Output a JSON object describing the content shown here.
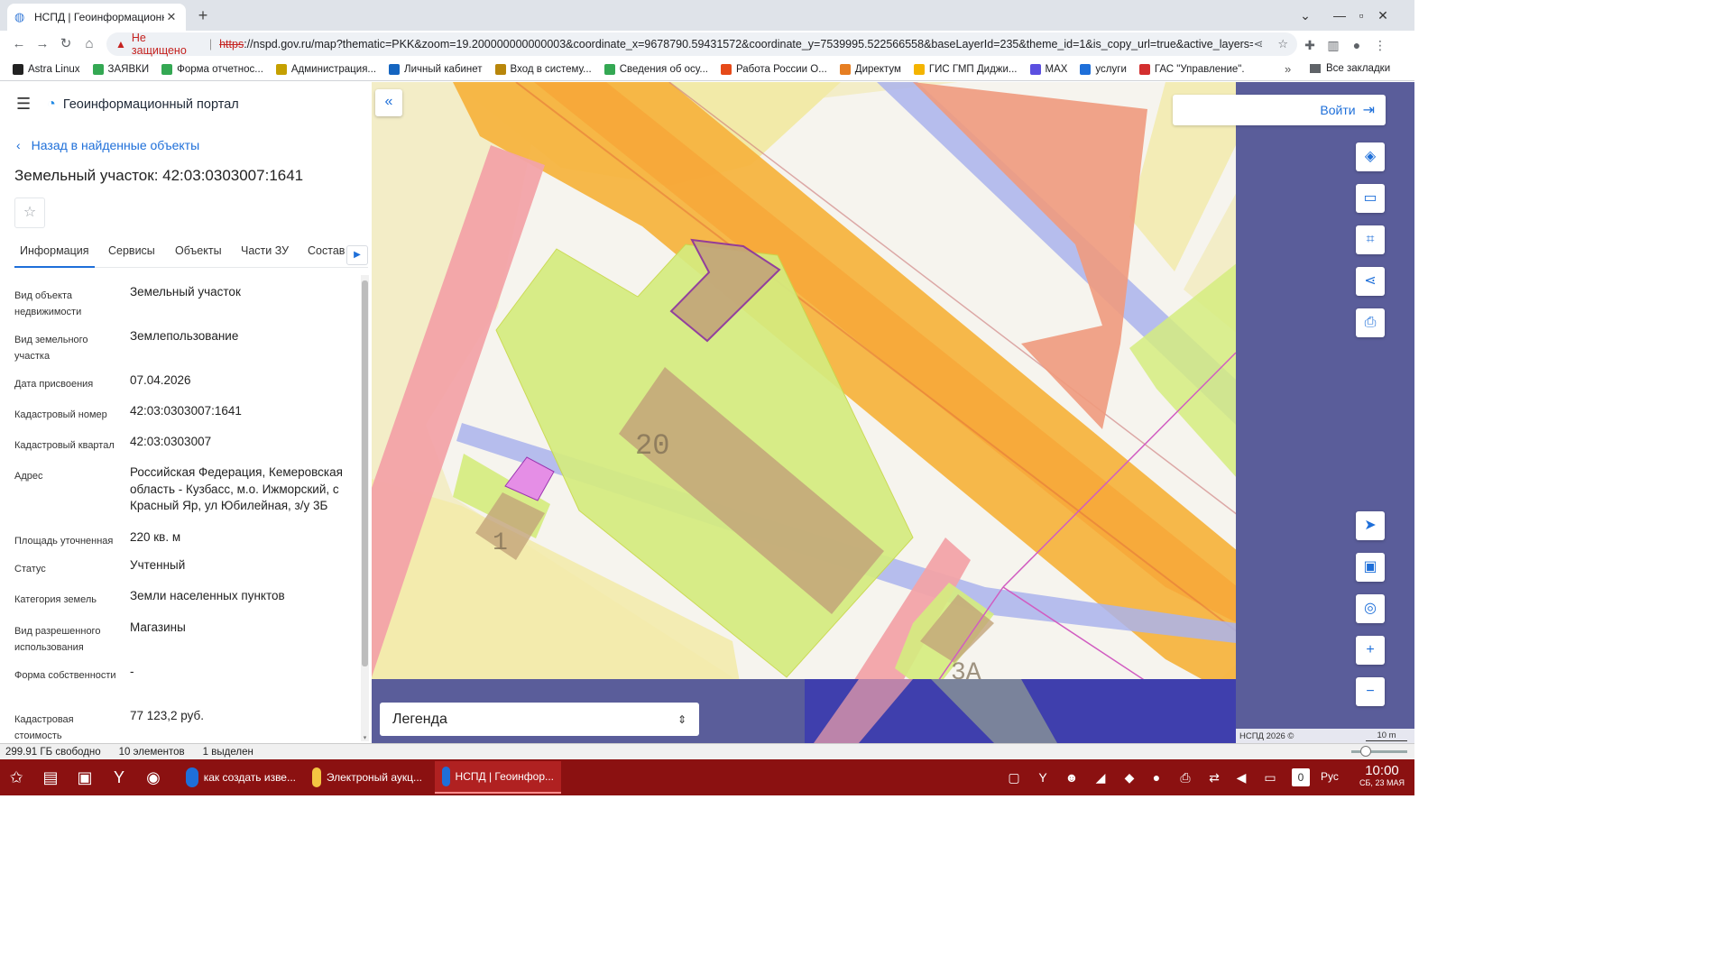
{
  "browser": {
    "tab_title": "НСПД | Геоинформационн",
    "tab_favicon": "globe-icon",
    "new_tab": "+",
    "security_label": "Не защищено",
    "url_scheme": "https",
    "url_rest": "://nspd.gov.ru/map?thematic=PKK&zoom=19.200000000000003&coordinate_x=9678790.59431572&coordinate_y=7539995.522566558&baseLayerId=235&theme_id=1&is_copy_url=true&active_layers=377..."
  },
  "bookmarks": [
    {
      "label": "Astra Linux",
      "color": "#222222"
    },
    {
      "label": "ЗАЯВКИ",
      "color": "#34a853"
    },
    {
      "label": "Форма отчетнос...",
      "color": "#34a853"
    },
    {
      "label": "Администрация...",
      "color": "#c5a000"
    },
    {
      "label": "Личный кабинет",
      "color": "#1565c0"
    },
    {
      "label": "Вход в систему...",
      "color": "#b8860b"
    },
    {
      "label": "Сведения об осу...",
      "color": "#34a853"
    },
    {
      "label": "Работа России О...",
      "color": "#e64a19"
    },
    {
      "label": "Директум",
      "color": "#e67e22"
    },
    {
      "label": "ГИС ГМП Диджи...",
      "color": "#f4b400"
    },
    {
      "label": "MAX",
      "color": "#5b4fe0"
    },
    {
      "label": "услуги",
      "color": "#1e6fd9"
    },
    {
      "label": "ГАС \"Управление\".",
      "color": "#d32f2f"
    }
  ],
  "bookmarks_more": "»",
  "bookmarks_all": "Все закладки",
  "panel": {
    "app_title": "Геоинформационный портал",
    "back_label": "Назад в найденные объекты",
    "object_title": "Земельный участок: 42:03:0303007:1641",
    "tabs": [
      "Информация",
      "Сервисы",
      "Объекты",
      "Части ЗУ",
      "Состав"
    ],
    "active_tab": "Информация",
    "fields": [
      {
        "label": "Вид объекта недвижимости",
        "value": "Земельный участок"
      },
      {
        "label": "Вид земельного участка",
        "value": "Землепользование"
      },
      {
        "label": "Дата присвоения",
        "value": "07.04.2026"
      },
      {
        "label": "Кадастровый номер",
        "value": "42:03:0303007:1641"
      },
      {
        "label": "Кадастровый квартал",
        "value": "42:03:0303007"
      },
      {
        "label": "Адрес",
        "value": "Российская Федерация, Кемеровская область - Кузбасс, м.о. Ижморский, с Красный Яр, ул Юбилейная, з/у 3Б"
      },
      {
        "label": "Площадь уточненная",
        "value": "220 кв. м"
      },
      {
        "label": "Статус",
        "value": "Учтенный"
      },
      {
        "label": "Категория земель",
        "value": "Земли населенных пунктов"
      },
      {
        "label": "Вид разрешенного использования",
        "value": "Магазины"
      },
      {
        "label": "Форма собственности",
        "value": "-"
      },
      {
        "label": "Кадастровая стоимость",
        "value": "77 123,2 руб."
      }
    ]
  },
  "map": {
    "login_label": "Войти",
    "legend_label": "Легенда",
    "attribution": "НСПД 2026 ©",
    "scale_label": "10 m",
    "labels": [
      "20",
      "1",
      "3А"
    ],
    "colors": {
      "background": "#f4f2ee",
      "yellow_zone": "#f2eaa8",
      "road_orange": "#f6b440",
      "pink_zone": "#f2a3a8",
      "blue_band": "#aab3ec",
      "green_parcel": "#d5ec7f",
      "building": "#c3a479",
      "selected_parcel": "#c3a479",
      "selected_border": "#8b2fa0",
      "salmon_zone": "#ef9a7d",
      "navy_side": "#5a5d9a",
      "deep_blue": "#3f3fad"
    },
    "tools": [
      "layers-icon",
      "ruler-icon",
      "zoom-select-icon",
      "share-icon",
      "print-icon",
      "locate-icon",
      "minimap-icon",
      "search-location-icon",
      "zoom-in-icon",
      "zoom-out-icon"
    ]
  },
  "fm_status": {
    "free": "299.91 ГБ свободно",
    "items": "10 элементов",
    "selected": "1 выделен"
  },
  "taskbar": {
    "tasks": [
      {
        "label": "как создать изве...",
        "color": "#1e6fd9"
      },
      {
        "label": "Электроный аукц...",
        "color": "#f4c542"
      },
      {
        "label": "НСПД | Геоинфор...",
        "color": "#1e6fd9"
      }
    ],
    "counter": "0",
    "lang": "Рус",
    "time": "10:00",
    "date": "СБ, 23 МАЯ"
  }
}
